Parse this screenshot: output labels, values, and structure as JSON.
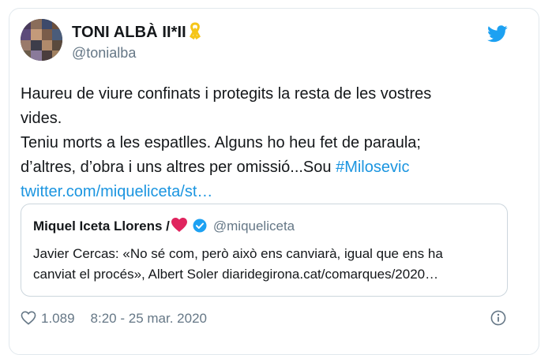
{
  "author": {
    "name": "TONI ALBÀ II*II",
    "handle": "@tonialba"
  },
  "icons": {
    "ribbon": "yellow-ribbon-icon",
    "bird": "twitter-bird-icon",
    "like": "heart-outline-icon",
    "info": "info-icon",
    "verified": "verified-badge-icon"
  },
  "colors": {
    "link": "#1b95e0",
    "secondary": "#657786",
    "ribbon": "#f5c518",
    "heart": "#e0245e"
  },
  "tweet": {
    "line1": "Haureu de viure confinats i protegits la resta de les vostres",
    "line2": "vides.",
    "line3": "Teniu morts a les espatlles. Alguns ho heu fet de paraula;",
    "line4_text": "d’altres, d’obra  i uns altres per omissió...Sou ",
    "hashtag": "#Milosevic",
    "link": "twitter.com/miqueliceta/st…"
  },
  "quote": {
    "name": "Miquel Iceta Llorens /",
    "handle": "@miqueliceta",
    "line1": "Javier Cercas: «No sé com, però això ens canviarà, igual que ens ha",
    "line2": "canviat el procés», Albert Soler diaridegirona.cat/comarques/2020…"
  },
  "footer": {
    "likes": "1.089",
    "timestamp": "8:20 - 25 mar. 2020"
  }
}
